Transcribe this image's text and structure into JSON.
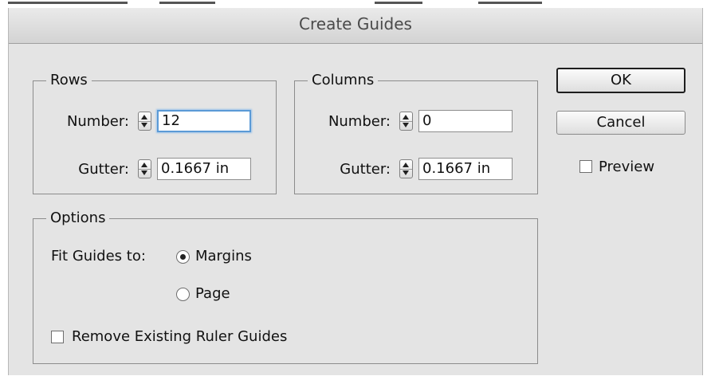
{
  "dialog": {
    "title": "Create Guides"
  },
  "rows": {
    "legend": "Rows",
    "number_label": "Number:",
    "number_value": "12",
    "gutter_label": "Gutter:",
    "gutter_value": "0.1667 in"
  },
  "columns": {
    "legend": "Columns",
    "number_label": "Number:",
    "number_value": "0",
    "gutter_label": "Gutter:",
    "gutter_value": "0.1667 in"
  },
  "options": {
    "legend": "Options",
    "fit_label": "Fit Guides to:",
    "fit_choices": [
      {
        "label": "Margins",
        "selected": true
      },
      {
        "label": "Page",
        "selected": false
      }
    ],
    "remove_label": "Remove Existing Ruler Guides",
    "remove_checked": false
  },
  "buttons": {
    "ok": "OK",
    "cancel": "Cancel"
  },
  "preview": {
    "label": "Preview",
    "checked": false
  },
  "colors": {
    "dialog_bg": "#e4e4e4",
    "focus_ring": "#5b9ad6"
  },
  "icons": [
    "stepper-icon",
    "radio-selected-icon",
    "radio-icon",
    "checkbox-icon"
  ]
}
